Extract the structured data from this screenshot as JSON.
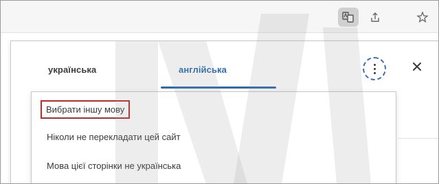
{
  "toolbar": {
    "translate_icon": "translate-icon",
    "share_icon": "share-icon",
    "favorite_icon": "star-icon"
  },
  "popup": {
    "tabs": [
      {
        "label": "українська"
      },
      {
        "label": "англійська"
      }
    ],
    "more_icon": "more-vert-icon",
    "close_icon": "close-icon"
  },
  "menu": {
    "items": [
      {
        "label": "Вибрати іншу мову"
      },
      {
        "label": "Ніколи не перекладати цей сайт"
      },
      {
        "label": "Мова цієї сторінки не українська"
      }
    ]
  },
  "colors": {
    "accent": "#2b6cb0",
    "highlight_border": "#c62828"
  }
}
